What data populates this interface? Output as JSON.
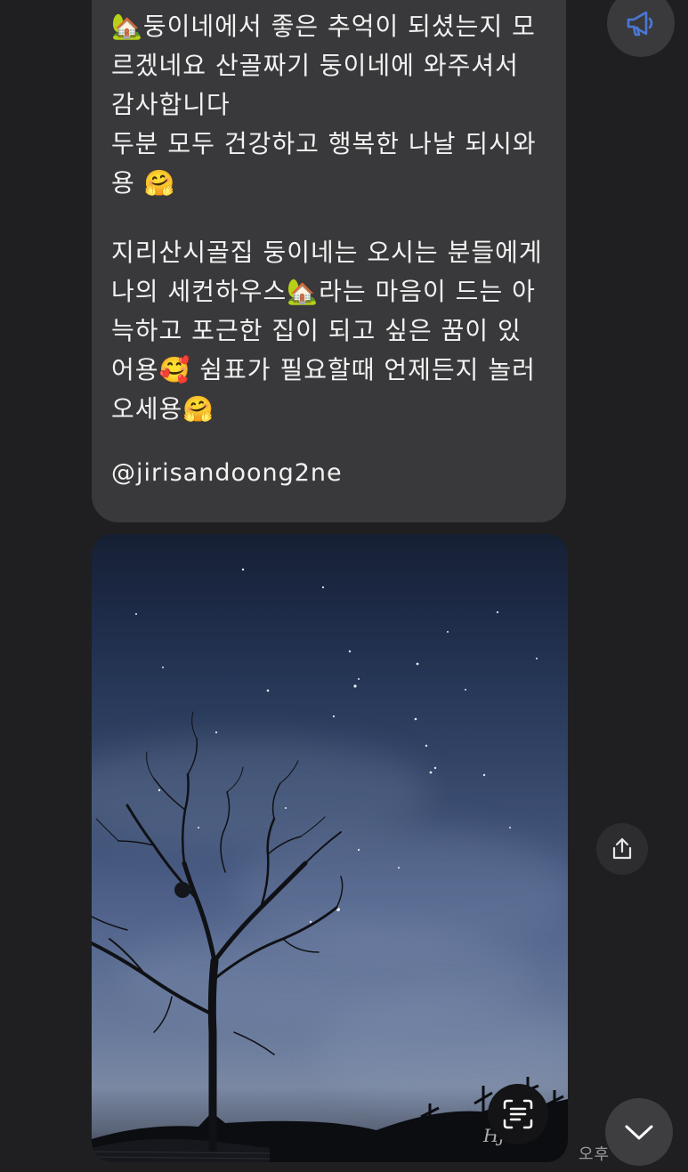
{
  "message": {
    "lines": [
      "🏡둥이네에서 좋은 추억이 되셨는지 모",
      "르겠네요 산골짜기 둥이네에 와주셔서",
      "감사합니다",
      "두분 모두 건강하고 행복한 나날 되시와",
      "용 🤗",
      "",
      "지리산시골집 둥이네는 오시는 분들에게",
      "나의 세컨하우스🏡라는 마음이 드는 아",
      "늑하고 포근한 집이 되고 싶은 꿈이 있",
      "어용🥰 쉼표가 필요할때 언제든지 놀러",
      "오세용🤗"
    ],
    "handle": "@jirisandoong2ne"
  },
  "photo": {
    "watermark": "Hj..."
  },
  "timestamp": "오후",
  "icons": {
    "announce": "megaphone-icon",
    "share": "share-icon",
    "scan": "text-scan-icon",
    "scroll": "chevron-down-icon"
  },
  "colors": {
    "background": "#1f1f21",
    "bubble": "#39393b",
    "accent": "#4a78d6"
  }
}
